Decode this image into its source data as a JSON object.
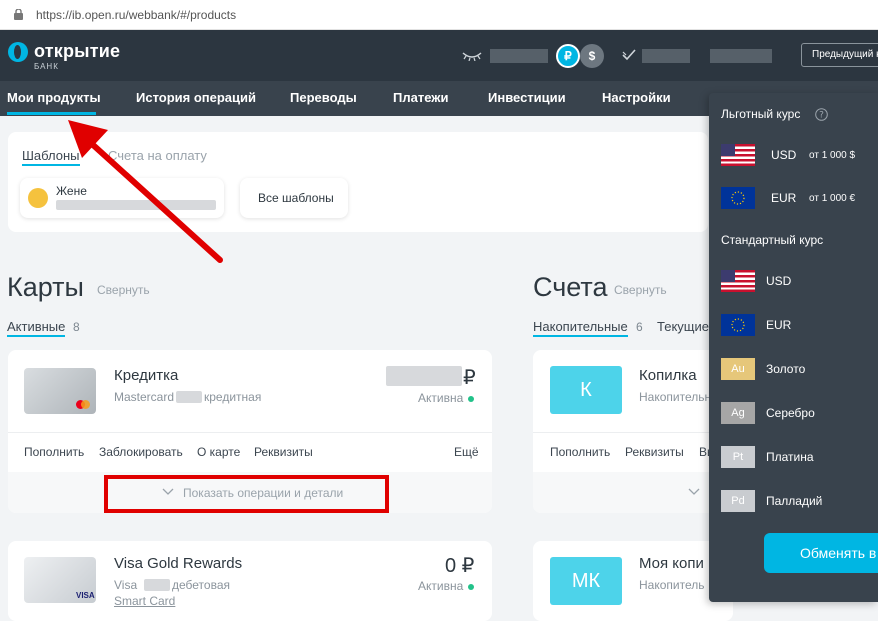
{
  "browser": {
    "url": "https://ib.open.ru/webbank/#/products"
  },
  "header": {
    "logo_name": "открытие",
    "logo_sub": "БАНК",
    "currency_rub": "₽",
    "currency_usd": "$",
    "previous_label": "Предыдущий к"
  },
  "nav": {
    "items": [
      "Мои продукты",
      "История операций",
      "Переводы",
      "Платежи",
      "Инвестиции",
      "Настройки"
    ]
  },
  "templates": {
    "tabs": [
      "Шаблоны",
      "Счета на оплату"
    ],
    "template_name": "Жене",
    "all_templates": "Все шаблоны"
  },
  "cards": {
    "title": "Карты",
    "collapse": "Свернуть",
    "tab_active": "Активные",
    "tab_count": "8",
    "items": [
      {
        "name": "Кредитка",
        "system": "Mastercard",
        "type": "кредитная",
        "currency": "₽",
        "status": "Активна",
        "actions": [
          "Пополнить",
          "Заблокировать",
          "О карте",
          "Реквизиты",
          "Ещё"
        ],
        "details": "Показать операции и детали"
      },
      {
        "name": "Visa Gold Rewards",
        "system": "Visa",
        "type": "дебетовая",
        "link": "Smart Card",
        "balance": "0 ₽",
        "status": "Активна"
      }
    ]
  },
  "accounts": {
    "title": "Счета",
    "collapse": "Свернуть",
    "tab_active": "Накопительные",
    "tab_count": "6",
    "tab_other": "Текущие",
    "items": [
      {
        "tile": "К",
        "name": "Копилка",
        "sub": "Накопительн",
        "actions": [
          "Пополнить",
          "Реквизиты",
          "Вы"
        ]
      },
      {
        "tile": "МК",
        "name": "Моя копи",
        "sub": "Накопитель"
      }
    ]
  },
  "rates": {
    "preferential_title": "Льготный курс",
    "preferential": [
      {
        "code": "USD",
        "from": "от 1 000 $"
      },
      {
        "code": "EUR",
        "from": "от 1 000 €"
      }
    ],
    "standard_title": "Стандартный курс",
    "standard": [
      {
        "code": "USD"
      },
      {
        "code": "EUR"
      }
    ],
    "metals": [
      {
        "symbol": "Au",
        "name": "Золото",
        "color": "#e6c77a"
      },
      {
        "symbol": "Ag",
        "name": "Серебро",
        "color": "#a6a6a6"
      },
      {
        "symbol": "Pt",
        "name": "Платина",
        "color": "#c9ccd0"
      },
      {
        "symbol": "Pd",
        "name": "Палладий",
        "color": "#c9ccd0"
      }
    ],
    "exchange_button": "Обменять в"
  },
  "colors": {
    "accent": "#00b6e3",
    "header": "#2c3640",
    "nav": "#39434d",
    "annotation": "#e00000"
  }
}
